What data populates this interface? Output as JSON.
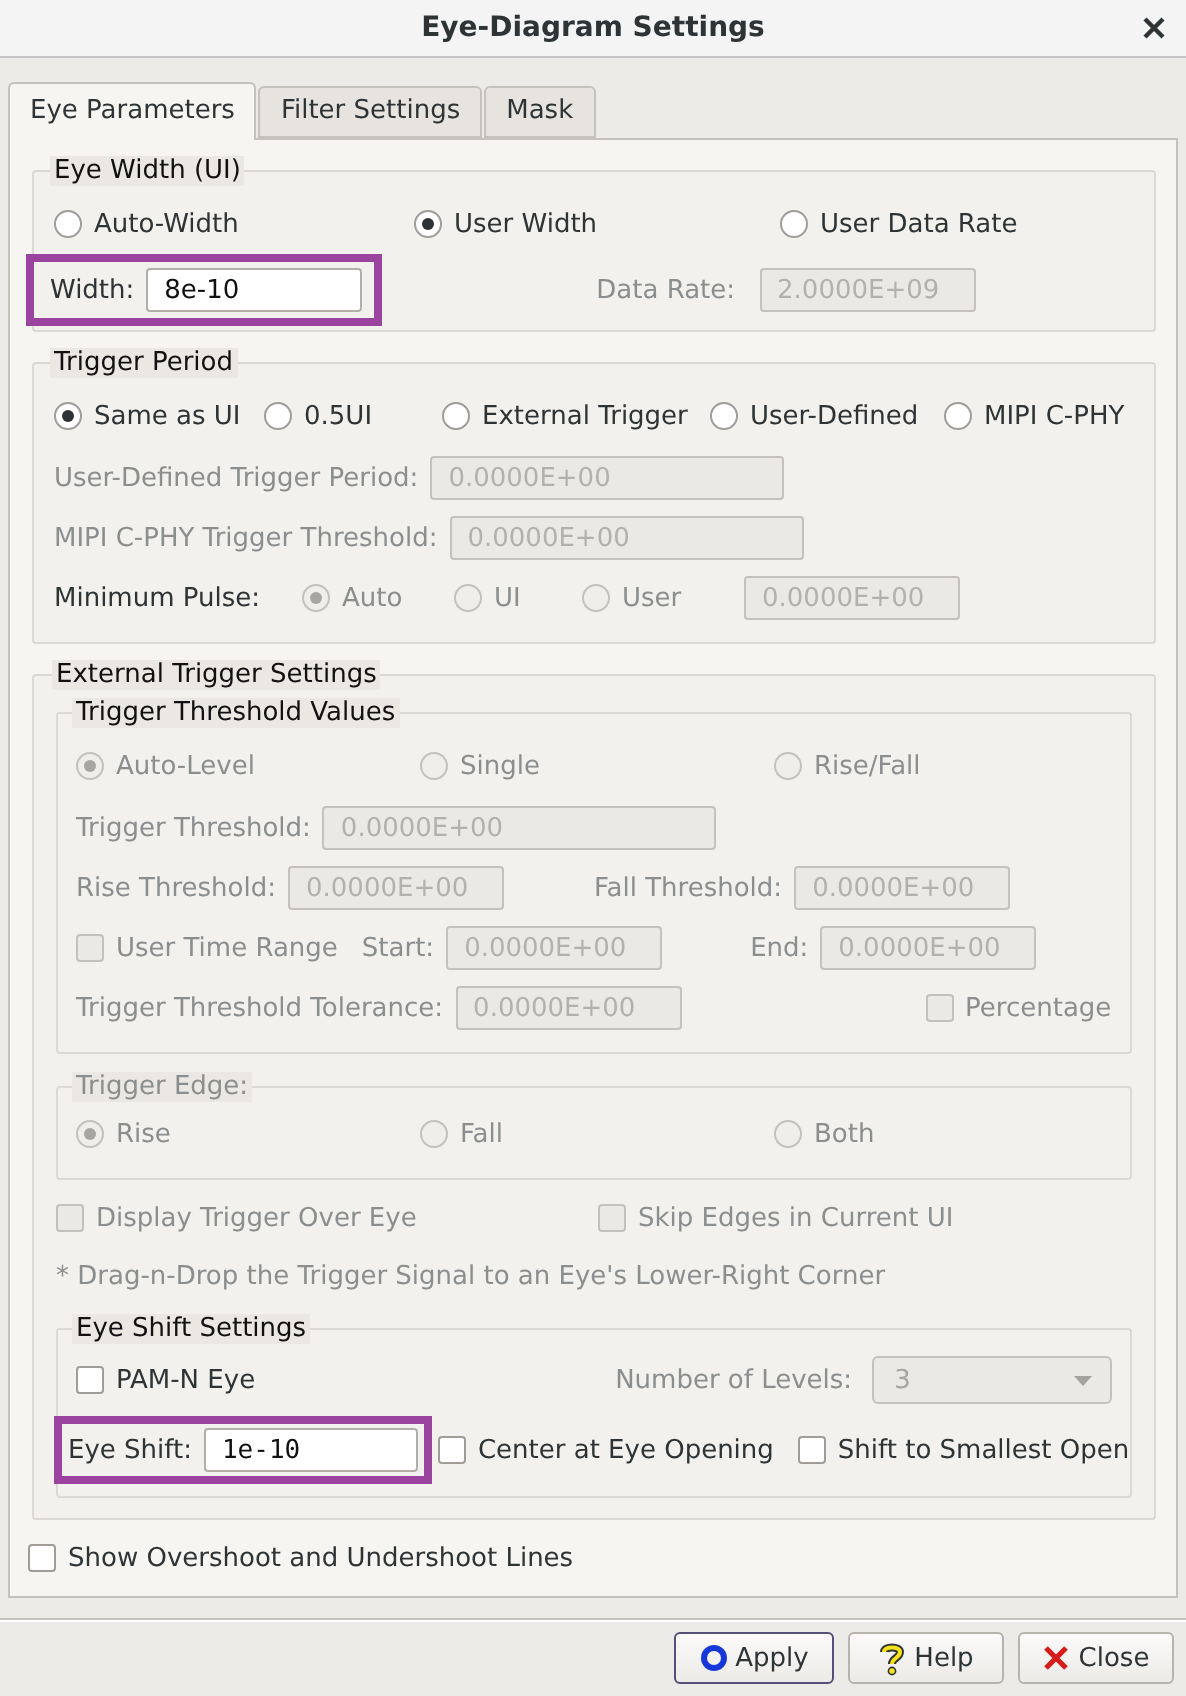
{
  "window": {
    "title": "Eye-Diagram Settings"
  },
  "tabs": [
    {
      "label": "Eye Parameters",
      "selected": true
    },
    {
      "label": "Filter Settings",
      "selected": false
    },
    {
      "label": "Mask",
      "selected": false
    }
  ],
  "eye_width": {
    "title": "Eye Width (UI)",
    "options": [
      {
        "label": "Auto-Width",
        "selected": false
      },
      {
        "label": "User Width",
        "selected": true
      },
      {
        "label": "User Data Rate",
        "selected": false
      }
    ],
    "width": {
      "label": "Width:",
      "value": "8e-10",
      "highlighted": true,
      "disabled": false
    },
    "data_rate": {
      "label": "Data Rate:",
      "value": "2.0000E+09",
      "disabled": true
    }
  },
  "trigger_period": {
    "title": "Trigger Period",
    "options": [
      {
        "label": "Same as UI",
        "selected": true
      },
      {
        "label": "0.5UI",
        "selected": false
      },
      {
        "label": "External Trigger",
        "selected": false
      },
      {
        "label": "User-Defined",
        "selected": false
      },
      {
        "label": "MIPI C-PHY",
        "selected": false
      }
    ],
    "fields": [
      {
        "label": "User-Defined Trigger Period:",
        "value": "0.0000E+00",
        "disabled": true
      },
      {
        "label": "MIPI C-PHY Trigger Threshold:",
        "value": "0.0000E+00",
        "disabled": true
      }
    ],
    "minimum_pulse": {
      "label": "Minimum Pulse:",
      "options": [
        {
          "label": "Auto",
          "selected": true,
          "disabled": true
        },
        {
          "label": "UI",
          "selected": false,
          "disabled": true
        },
        {
          "label": "User",
          "selected": false,
          "disabled": true
        }
      ],
      "value": "0.0000E+00",
      "disabled": true
    }
  },
  "external_trigger": {
    "title": "External Trigger Settings",
    "threshold_values": {
      "title": "Trigger Threshold Values",
      "options": [
        {
          "label": "Auto-Level",
          "selected": true,
          "disabled": true
        },
        {
          "label": "Single",
          "selected": false,
          "disabled": true
        },
        {
          "label": "Rise/Fall",
          "selected": false,
          "disabled": true
        }
      ],
      "trigger_threshold": {
        "label": "Trigger Threshold:",
        "value": "0.0000E+00",
        "disabled": true
      },
      "rise_threshold": {
        "label": "Rise Threshold:",
        "value": "0.0000E+00",
        "disabled": true
      },
      "fall_threshold": {
        "label": "Fall Threshold:",
        "value": "0.0000E+00",
        "disabled": true
      },
      "user_time_range": {
        "label": "User Time Range",
        "checked": false,
        "disabled": true
      },
      "start": {
        "label": "Start:",
        "value": "0.0000E+00",
        "disabled": true
      },
      "end": {
        "label": "End:",
        "value": "0.0000E+00",
        "disabled": true
      },
      "tolerance": {
        "label": "Trigger Threshold Tolerance:",
        "value": "0.0000E+00",
        "disabled": true
      },
      "percentage": {
        "label": "Percentage",
        "checked": false,
        "disabled": true
      }
    },
    "trigger_edge": {
      "title": "Trigger Edge:",
      "disabled": true,
      "options": [
        {
          "label": "Rise",
          "selected": true
        },
        {
          "label": "Fall",
          "selected": false
        },
        {
          "label": "Both",
          "selected": false
        }
      ]
    },
    "display_trigger": {
      "label": "Display Trigger Over Eye",
      "checked": false,
      "disabled": true
    },
    "skip_edges": {
      "label": "Skip Edges in Current UI",
      "checked": false,
      "disabled": true
    },
    "note": {
      "text": "* Drag-n-Drop the Trigger Signal to an Eye's Lower-Right Corner",
      "disabled": true
    },
    "eye_shift": {
      "title": "Eye Shift Settings",
      "pam_n_eye": {
        "label": "PAM-N Eye",
        "checked": false,
        "disabled": false
      },
      "number_of_levels": {
        "label": "Number of Levels:",
        "value": "3",
        "disabled": true
      },
      "shift": {
        "label": "Eye Shift:",
        "value": "1e-10",
        "highlighted": true,
        "disabled": false
      },
      "center": {
        "label": "Center at Eye Opening",
        "checked": false,
        "disabled": false
      },
      "smallest": {
        "label": "Shift to Smallest Open",
        "checked": false,
        "disabled": false
      }
    }
  },
  "show_overshoot": {
    "label": "Show Overshoot and Undershoot Lines",
    "checked": false,
    "disabled": false
  },
  "buttons": [
    {
      "label": "Apply",
      "kind": "apply",
      "default": true
    },
    {
      "label": "Help",
      "kind": "help",
      "default": false
    },
    {
      "label": "Close",
      "kind": "close",
      "default": false
    }
  ]
}
